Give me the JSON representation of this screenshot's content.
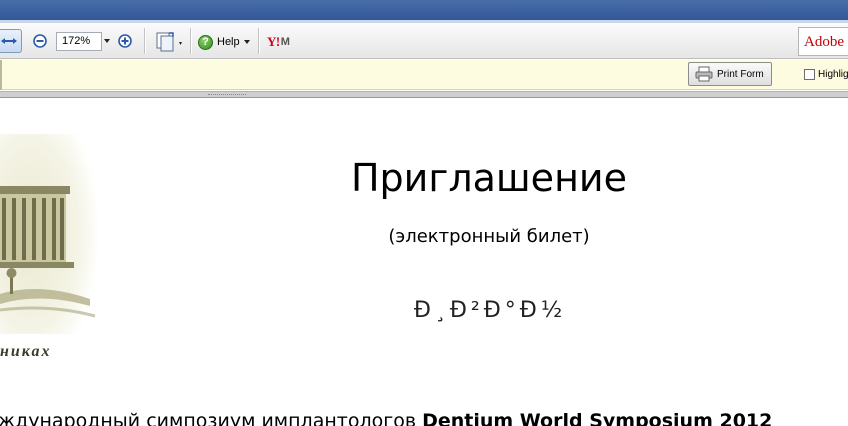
{
  "toolbar": {
    "zoom_value": "172%",
    "help_label": "Help",
    "yahoo_label": "Y!",
    "yahoo_mail_label": "M",
    "adobe_label": "Adobe"
  },
  "formbar": {
    "print_form_label": "Print Form",
    "highlight_label": "Highlig"
  },
  "document": {
    "logo_caption": "никах",
    "title": "Приглашение",
    "subtitle": "(электронный билет)",
    "garbled_text": "Ð¸Ð²Ð°Ð½",
    "intro_text": "ждународный симпозиум имплантологов ",
    "intro_bold": "Dentium World Symposium 2012"
  },
  "colors": {
    "titlebar": "#2f5597",
    "formbar_bg": "#fdfbe0",
    "adobe_red": "#c40000"
  }
}
